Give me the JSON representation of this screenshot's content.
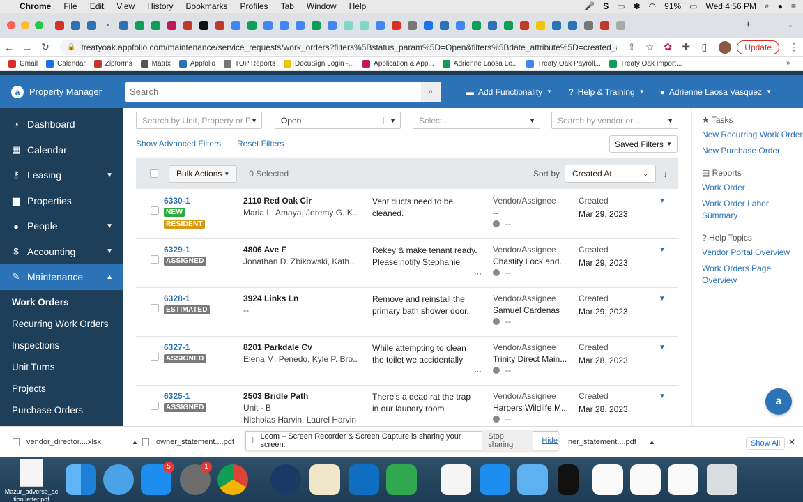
{
  "menubar": {
    "apple": "",
    "items": [
      "Chrome",
      "File",
      "Edit",
      "View",
      "History",
      "Bookmarks",
      "Profiles",
      "Tab",
      "Window",
      "Help"
    ],
    "battery": "91%",
    "clock": "Wed 4:56 PM"
  },
  "browser": {
    "url": "treatyoak.appfolio.com/maintenance/service_requests/work_orders?filters%5Bstatus_param%5D=Open&filters%5Bdate_attribute%5D=created_at&so...",
    "update_label": "Update"
  },
  "bookmarks": [
    {
      "label": "Gmail",
      "color": "#d93025"
    },
    {
      "label": "Calendar",
      "color": "#1a73e8"
    },
    {
      "label": "Zipforms",
      "color": "#c0392b"
    },
    {
      "label": "Matrix",
      "color": "#555555"
    },
    {
      "label": "Appfolio",
      "color": "#2b73b6"
    },
    {
      "label": "TOP Reports",
      "color": "#777777"
    },
    {
      "label": "DocuSign Login -...",
      "color": "#f5c400"
    },
    {
      "label": "Application & App...",
      "color": "#c2185b"
    },
    {
      "label": "Adrienne Laosa Le...",
      "color": "#0f9d58"
    },
    {
      "label": "Treaty Oak Payroll...",
      "color": "#4285f4"
    },
    {
      "label": "Treaty Oak Import...",
      "color": "#0f9d58"
    }
  ],
  "header": {
    "brand": "Property Manager",
    "search_placeholder": "Search",
    "add_functionality": "Add Functionality",
    "help_training": "Help & Training",
    "user": "Adrienne Laosa Vasquez"
  },
  "sidebar": {
    "items": [
      {
        "label": "Dashboard",
        "icon": "◔",
        "chevron": ""
      },
      {
        "label": "Calendar",
        "icon": "▦",
        "chevron": ""
      },
      {
        "label": "Leasing",
        "icon": "⚷",
        "chevron": "▼"
      },
      {
        "label": "Properties",
        "icon": "▆",
        "chevron": ""
      },
      {
        "label": "People",
        "icon": "●",
        "chevron": "▼"
      },
      {
        "label": "Accounting",
        "icon": "$",
        "chevron": "▼"
      },
      {
        "label": "Maintenance",
        "icon": "✎",
        "chevron": "▲"
      }
    ],
    "sub_items": [
      "Work Orders",
      "Recurring Work Orders",
      "Inspections",
      "Unit Turns",
      "Projects",
      "Purchase Orders"
    ]
  },
  "filters": {
    "unit_placeholder": "Search by Unit, Property or P...",
    "status_value": "Open",
    "select_placeholder": "Select...",
    "vendor_placeholder": "Search by vendor or ...",
    "show_advanced": "Show Advanced Filters",
    "reset": "Reset Filters",
    "saved": "Saved Filters"
  },
  "toolbar": {
    "bulk_actions": "Bulk Actions",
    "selected": "0 Selected",
    "sort_by_label": "Sort by",
    "sort_value": "Created At"
  },
  "work_orders": [
    {
      "number": "6330-1",
      "badges": [
        {
          "text": "NEW",
          "color": "#2eaa3f"
        },
        {
          "text": "RESIDENT",
          "color": "#d89a12"
        }
      ],
      "address": "2110 Red Oak Cir",
      "unit": "",
      "tenants": "Maria L. Amaya, Jeremy G. K...",
      "description": "Vent ducts need to be cleaned.",
      "more": "",
      "vendor_label": "Vendor/Assignee",
      "vendor": "--",
      "assignee": "--",
      "created_label": "Created",
      "created": "Mar 29, 2023"
    },
    {
      "number": "6329-1",
      "badges": [
        {
          "text": "ASSIGNED",
          "color": "#7a7a7a"
        }
      ],
      "address": "4806 Ave F",
      "unit": "",
      "tenants": "Jonathan D. Zbikowski, Kath...",
      "description": "Rekey & make tenant ready. Please notify Stephanie once completed",
      "more": "···",
      "vendor_label": "Vendor/Assignee",
      "vendor": "Chastity Lock and...",
      "assignee": "--",
      "created_label": "Created",
      "created": "Mar 29, 2023"
    },
    {
      "number": "6328-1",
      "badges": [
        {
          "text": "ESTIMATED",
          "color": "#7a7a7a"
        }
      ],
      "address": "3924 Links Ln",
      "unit": "",
      "tenants": "--",
      "description": "Remove and reinstall the primary bath shower door.",
      "more": "",
      "vendor_label": "Vendor/Assignee",
      "vendor": "Samuel Cardenas",
      "assignee": "--",
      "created_label": "Created",
      "created": "Mar 29, 2023"
    },
    {
      "number": "6327-1",
      "badges": [
        {
          "text": "ASSIGNED",
          "color": "#7a7a7a"
        }
      ],
      "address": "8201 Parkdale Cv",
      "unit": "",
      "tenants": "Elena M. Penedo, Kyle P. Bro...",
      "description": "While attempting to clean the toilet we accidentally knocked in a small face",
      "more": "···",
      "vendor_label": "Vendor/Assignee",
      "vendor": "Trinity Direct Main...",
      "assignee": "--",
      "created_label": "Created",
      "created": "Mar 28, 2023"
    },
    {
      "number": "6325-1",
      "badges": [
        {
          "text": "ASSIGNED",
          "color": "#7a7a7a"
        }
      ],
      "address": "2503 Bridle Path",
      "unit": "Unit - B",
      "tenants": "Nicholas Harvin, Laurel Harvin",
      "description": "There's a dead rat the trap in our laundry room",
      "more": "",
      "vendor_label": "Vendor/Assignee",
      "vendor": "Harpers Wildlife M...",
      "assignee": "--",
      "created_label": "Created",
      "created": "Mar 28, 2023"
    }
  ],
  "right_panel": {
    "tasks_title": "Tasks",
    "tasks": [
      "New Recurring Work Order",
      "New Purchase Order"
    ],
    "reports_title": "Reports",
    "reports": [
      "Work Order",
      "Work Order Labor Summary"
    ],
    "help_title": "Help Topics",
    "help": [
      "Vendor Portal Overview",
      "Work Orders Page Overview"
    ]
  },
  "downloads": {
    "file1": "vendor_director....xlsx",
    "file2": "owner_statement....pdf",
    "file3": "ner_statement....pdf",
    "show_all": "Show All"
  },
  "loom": {
    "message": "Loom – Screen Recorder & Screen Capture is sharing your screen.",
    "stop": "Stop sharing",
    "hide": "Hide"
  },
  "desktop": {
    "file_label": "Mazur_adverse_ac\ntion letter.pdf"
  },
  "dock": {
    "badge_messages": "5",
    "badge_other": "1"
  }
}
